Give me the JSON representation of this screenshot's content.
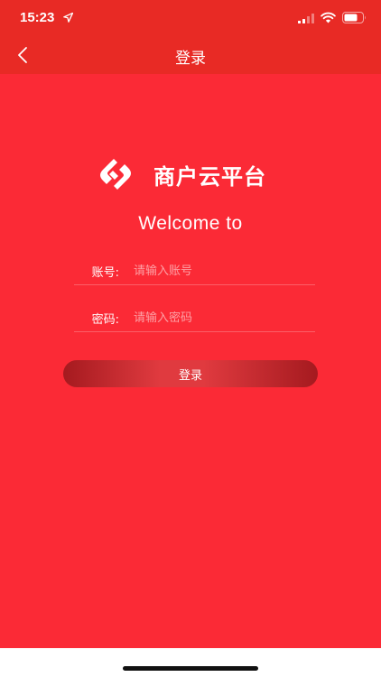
{
  "status": {
    "time": "15:23"
  },
  "nav": {
    "title": "登录"
  },
  "brand": {
    "name": "商户云平台",
    "welcome": "Welcome to"
  },
  "form": {
    "account_label": "账号:",
    "account_placeholder": "请输入账号",
    "password_label": "密码:",
    "password_placeholder": "请输入密码",
    "login_label": "登录"
  },
  "colors": {
    "background": "#fb2a36",
    "nav_background": "#e82a25",
    "button_dark": "#a51a1f"
  },
  "icons": [
    "location-arrow-icon",
    "signal-icon",
    "wifi-icon",
    "battery-icon",
    "back-chevron-icon",
    "logo-icon"
  ]
}
